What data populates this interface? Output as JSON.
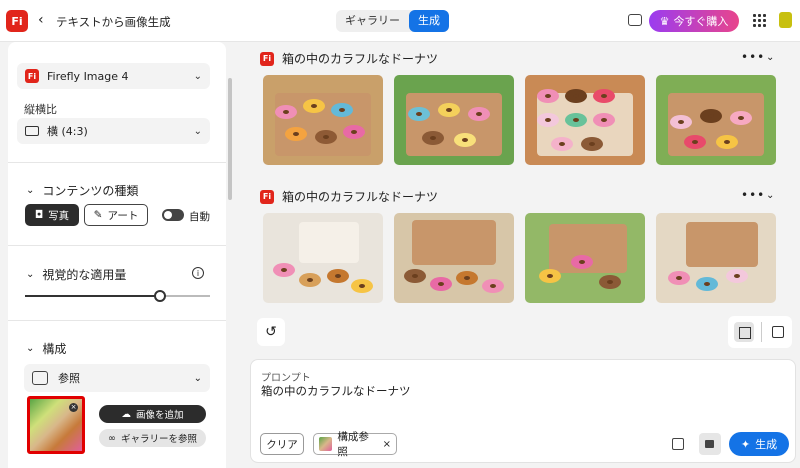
{
  "topbar": {
    "logo_text": "Fi",
    "back_icon": "chevron-left-icon",
    "title": "テキストから画像生成",
    "tabs": [
      {
        "label": "ギャラリー",
        "active": false
      },
      {
        "label": "生成",
        "active": true
      }
    ],
    "buy_label": "今すぐ購入",
    "accent_color": "#1473e6",
    "brand_color": "#e1251b"
  },
  "sidebar": {
    "model": {
      "badge": "Fi",
      "value": "Firefly Image 4"
    },
    "aspect": {
      "label": "縦横比",
      "value": "横 (4:3)"
    },
    "content_type": {
      "title": "コンテンツの種類",
      "photo_label": "写真",
      "art_label": "アート",
      "auto_label": "自動",
      "auto_on": true
    },
    "visual": {
      "title": "視覚的な適用量",
      "value": 0.73
    },
    "composition": {
      "title": "構成",
      "ref_label": "参照",
      "add_image_label": "画像を追加",
      "gallery_label": "ギャラリーを参照"
    }
  },
  "results": [
    {
      "title": "箱の中のカラフルなドーナツ",
      "badge": "Fi"
    },
    {
      "title": "箱の中のカラフルなドーナツ",
      "badge": "Fi"
    }
  ],
  "prompt": {
    "label": "プロンプト",
    "text": "箱の中のカラフルなドーナツ",
    "clear_label": "クリア",
    "chip_label": "構成参照",
    "generate_label": "生成"
  }
}
